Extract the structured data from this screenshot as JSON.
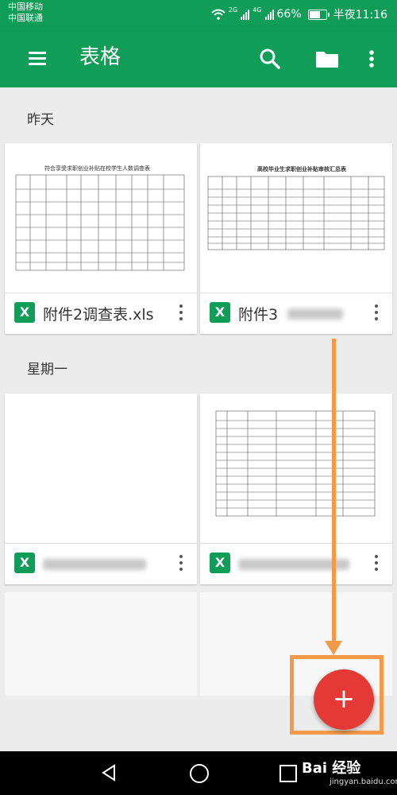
{
  "status": {
    "carrier1": "中国移动",
    "carrier2": "中国联通",
    "net1": "2G",
    "net2": "4G",
    "battery": "66%",
    "time": "半夜11:16"
  },
  "appbar": {
    "title": "表格",
    "icons": [
      "menu-icon",
      "search-icon",
      "folder-icon",
      "more-vert-icon"
    ]
  },
  "sections": [
    {
      "title": "昨天"
    },
    {
      "title": "星期一"
    }
  ],
  "files": [
    {
      "name": "附件2调查表.xls",
      "thumb_title": "符合享受求职创业补贴在校学生人数调查表",
      "icon_text": "X"
    },
    {
      "name": "附件3",
      "thumb_title": "高校毕业生求职创业补贴审核汇总表",
      "icon_text": "X"
    },
    {
      "name": "",
      "thumb_title": "",
      "icon_text": "X"
    },
    {
      "name": "",
      "thumb_title": "",
      "icon_text": "X"
    }
  ],
  "fab": {
    "label": "+",
    "icon": "add-icon"
  },
  "annotation": {
    "color": "#f39a4a"
  },
  "watermark": {
    "brand": "Bai 经验",
    "url": "jingyan.baidu.com"
  },
  "colors": {
    "primary": "#0f9d58",
    "fab": "#e53935",
    "annotation": "#f39a4a"
  }
}
